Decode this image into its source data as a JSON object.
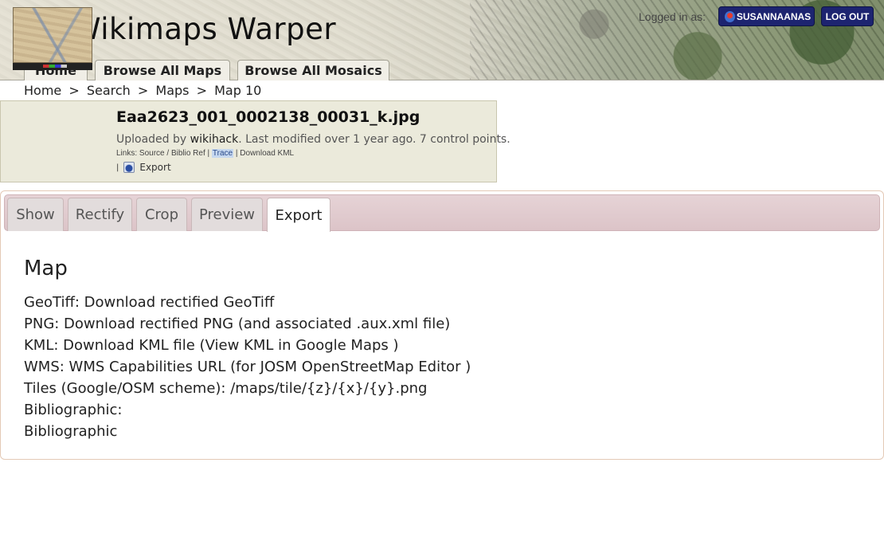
{
  "header": {
    "site_title": "Wikimaps Warper",
    "logged_in_label": "Logged in as:",
    "username": "SUSANNAANAS",
    "logout_label": "LOG OUT",
    "nav": [
      "Home",
      "Browse All Maps",
      "Browse All Mosaics"
    ]
  },
  "breadcrumb": [
    "Home",
    ">",
    "Search",
    ">",
    "Maps",
    ">",
    "Map 10"
  ],
  "map_info": {
    "title": "Eaa2623_001_0002138_00031_k.jpg",
    "uploaded_by_label": "Uploaded by",
    "uploader": "wikihack",
    "modified_text": ". Last modified over 1 year ago. 7 control points.",
    "links_label": "Links:",
    "links": [
      "Source",
      "/",
      "Biblio Ref",
      "|",
      "Trace",
      "|",
      "Download KML"
    ],
    "export_pipe": "|",
    "export_label": "Export"
  },
  "tabs": [
    "Show",
    "Rectify",
    "Crop",
    "Preview",
    "Export"
  ],
  "active_tab": "Export",
  "content": {
    "title": "Map",
    "items": [
      "GeoTiff: Download rectified GeoTiff",
      "PNG: Download rectified PNG (and associated .aux.xml file)",
      "KML: Download KML file (View KML in Google Maps )",
      "WMS: WMS Capabilities URL (for JOSM OpenStreetMap Editor )",
      "Tiles (Google/OSM scheme): /maps/tile/{z}/{x}/{y}.png",
      "Bibliographic:",
      "Bibliographic"
    ]
  }
}
